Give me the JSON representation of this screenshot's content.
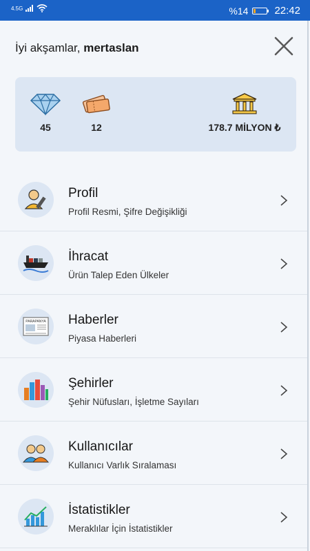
{
  "status_bar": {
    "network": "4.5G",
    "battery": "%14",
    "battery_level": 0.14,
    "time": "22:42"
  },
  "header": {
    "greeting": "İyi akşamlar,",
    "username": "mertaslan"
  },
  "stats": {
    "gems": {
      "icon": "diamond-icon",
      "value": "45"
    },
    "tickets": {
      "icon": "ticket-icon",
      "value": "12"
    },
    "money": {
      "icon": "bank-icon",
      "value": "178.7 MİLYON ₺"
    }
  },
  "menu": {
    "items": [
      {
        "title": "Profil",
        "subtitle": "Profil Resmi, Şifre Değişikliği",
        "icon": "profile-edit-icon"
      },
      {
        "title": "İhracat",
        "subtitle": "Ürün Talep Eden Ülkeler",
        "icon": "cargo-ship-icon"
      },
      {
        "title": "Haberler",
        "subtitle": "Piyasa Haberleri",
        "icon": "newspaper-icon",
        "icon_text": "PARAPANYA"
      },
      {
        "title": "Şehirler",
        "subtitle": "Şehir Nüfusları, İşletme Sayıları",
        "icon": "city-buildings-icon"
      },
      {
        "title": "Kullanıcılar",
        "subtitle": "Kullanıcı Varlık Sıralaması",
        "icon": "users-icon"
      },
      {
        "title": "İstatistikler",
        "subtitle": "Meraklılar İçin İstatistikler",
        "icon": "statistics-chart-icon"
      }
    ]
  },
  "colors": {
    "status_bar": "#1b63c7",
    "card": "#dce6f3",
    "background": "#f3f6fa"
  }
}
